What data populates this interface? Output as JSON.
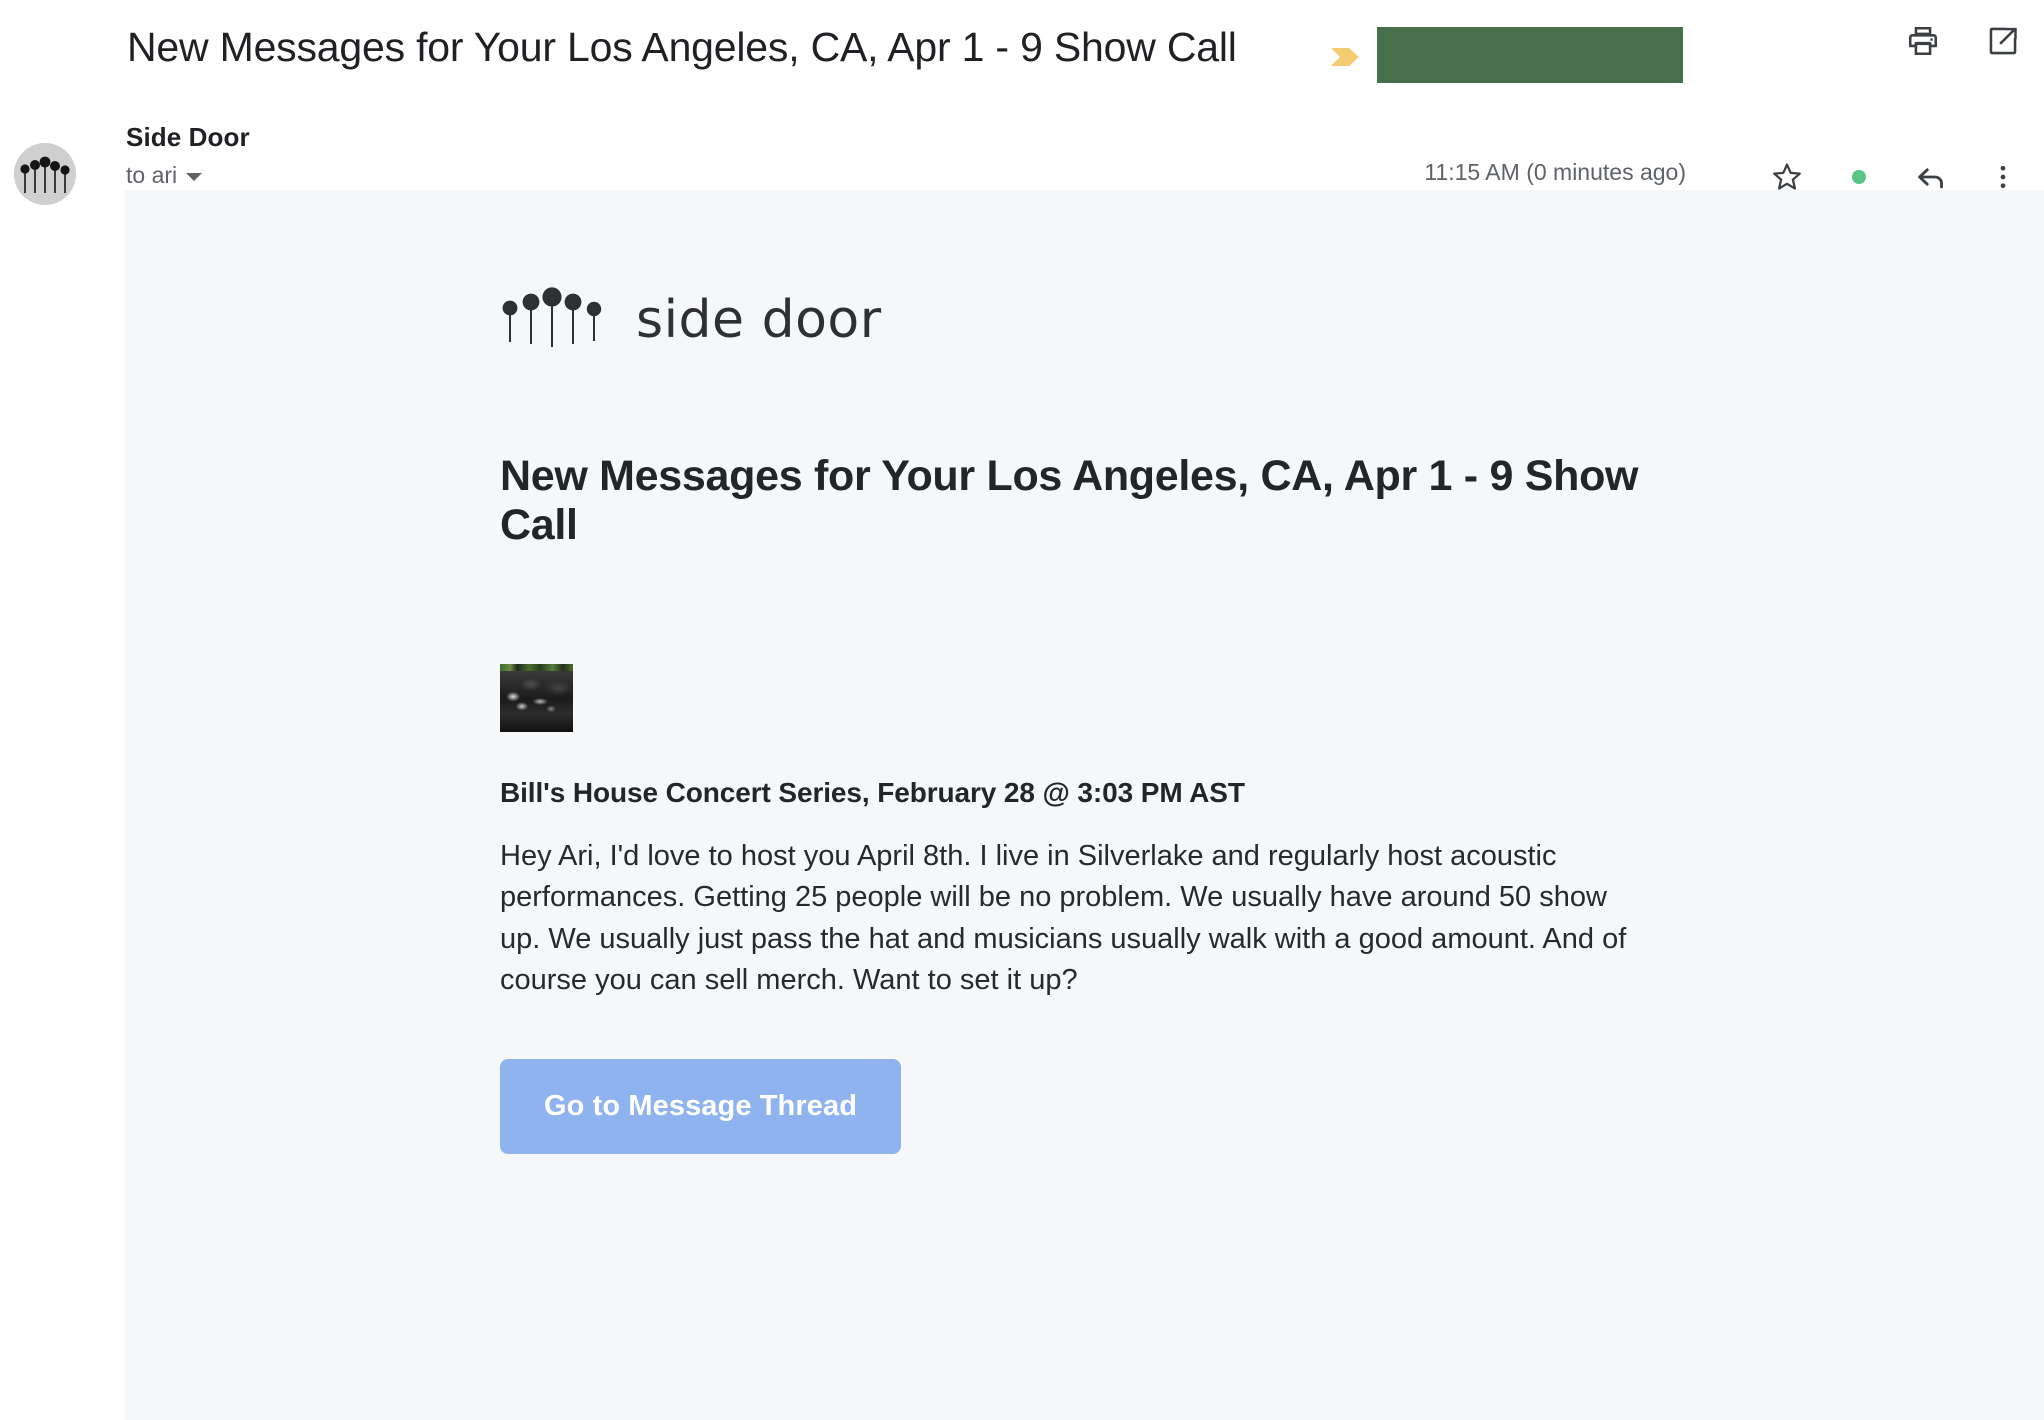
{
  "header": {
    "subject": "New Messages for Your Los Angeles, CA, Apr 1 - 9 Show Call",
    "label_chevron_color": "#f5cb72",
    "label_redacted_color": "#46704c",
    "print_icon": "print-icon",
    "open_in_new_icon": "open-in-new-window-icon"
  },
  "message": {
    "sender_name": "Side Door",
    "recipient": "to ari",
    "timestamp": "11:15 AM (0 minutes ago)",
    "star_icon": "star-outline-icon",
    "unread_dot_color": "#59c486",
    "reply_icon": "reply-icon",
    "more_icon": "more-vertical-icon",
    "avatar_label": "side-door-logo-avatar"
  },
  "email": {
    "brand_word": "side door",
    "headline": "New Messages for Your Los Angeles, CA, Apr 1 - 9 Show Call",
    "thumbnail_alt": "concert crowd photo",
    "subhead": "Bill's House Concert Series, February 28 @ 3:03 PM AST",
    "paragraph": "Hey Ari, I'd love to host you April 8th. I live in Silverlake and regularly host acoustic performances. Getting 25 people will be no problem. We usually have around 50 show up. We usually just pass the hat and musicians usually walk with a good amount. And of course you can sell merch. Want to set it up?",
    "cta_label": "Go to Message Thread",
    "cta_color": "#8fb3ef",
    "background_color": "#f6f7f9"
  }
}
